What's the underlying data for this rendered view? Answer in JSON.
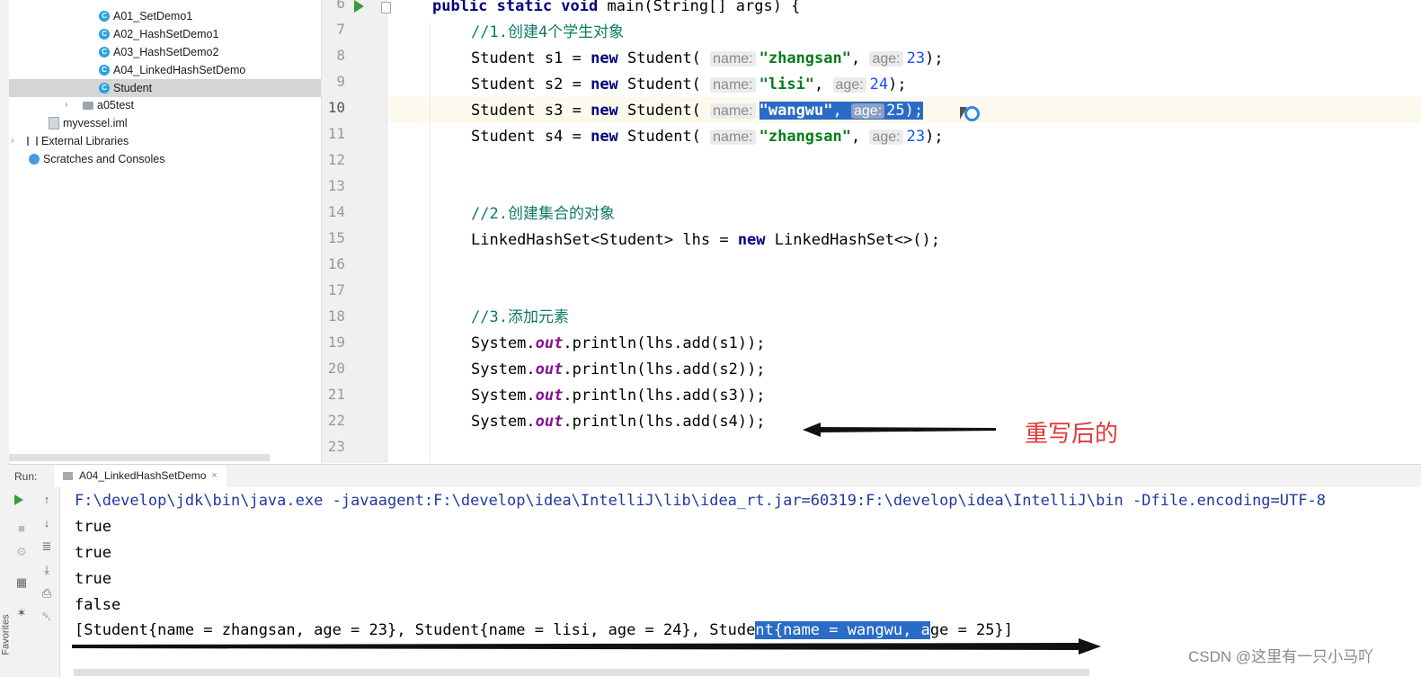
{
  "sidebar": {
    "favorites": "Favorites",
    "items": [
      {
        "label": "A01_SetDemo1",
        "icon": "class-icon"
      },
      {
        "label": "A02_HashSetDemo1",
        "icon": "class-icon"
      },
      {
        "label": "A03_HashSetDemo2",
        "icon": "class-icon"
      },
      {
        "label": "A04_LinkedHashSetDemo",
        "icon": "class-icon"
      },
      {
        "label": "Student",
        "icon": "class-icon",
        "selected": true
      },
      {
        "label": "a05test",
        "icon": "folder-icon"
      },
      {
        "label": "myvessel.iml",
        "icon": "iml-icon"
      },
      {
        "label": "External Libraries",
        "icon": "library-icon"
      },
      {
        "label": "Scratches and Consoles",
        "icon": "scratch-icon"
      }
    ]
  },
  "editor": {
    "line_numbers": [
      "6",
      "7",
      "8",
      "9",
      "10",
      "11",
      "12",
      "13",
      "14",
      "15",
      "16",
      "17",
      "18",
      "19",
      "20",
      "21",
      "22",
      "23"
    ],
    "current_line": "10",
    "code": {
      "l6_a": "public static void ",
      "l6_b": "main(String[] args) {",
      "l7": "//1.创建4个学生对象",
      "student_decl": "Student ",
      "new_kw": "new",
      "student_ctor": " Student( ",
      "name_hint": "name:",
      "age_hint": "age:",
      "s1": "s1 = ",
      "s1_name": "\"zhangsan\"",
      "s1_age": "23",
      "s2": "s2 = ",
      "s2_name": "\"lisi\"",
      "s2_age": "24",
      "s3": "s3 = ",
      "s3_name": "\"wangwu\"",
      "s3_age": "25",
      "s4": "s4 = ",
      "s4_name": "\"zhangsan\"",
      "s4_age": "23",
      "close": ");",
      "comma": ", ",
      "l14": "//2.创建集合的对象",
      "l15_a": "LinkedHashSet<Student> lhs = ",
      "l15_b": " LinkedHashSet<>();",
      "l18": "//3.添加元素",
      "sys": "System.",
      "out": "out",
      "add1": ".println(lhs.add(s1));",
      "add2": ".println(lhs.add(s2));",
      "add3": ".println(lhs.add(s3));",
      "add4": ".println(lhs.add(s4));"
    }
  },
  "annotation": {
    "text": "重写后的",
    "color": "#e0393b"
  },
  "run_panel": {
    "label": "Run:",
    "tab": "A04_LinkedHashSetDemo",
    "close": "×",
    "console": {
      "command": "F:\\develop\\jdk\\bin\\java.exe -javaagent:F:\\develop\\idea\\IntelliJ\\lib\\idea_rt.jar=60319:F:\\develop\\idea\\IntelliJ\\bin -Dfile.encoding=UTF-8",
      "out1": "true",
      "out2": "true",
      "out3": "true",
      "out4": "false",
      "result_a": "[Student{name = zhangsan, age = 23}, Student{name = lisi, age = 24}, Stude",
      "result_sel": "nt{name = wangwu, a",
      "result_b": "ge = 25}]"
    }
  },
  "watermark": "CSDN @这里有一只小马吖",
  "colors": {
    "keyword": "#000080",
    "comment": "#0b7a65",
    "string": "#067d17",
    "number": "#1750eb",
    "selection": "#2a6bc7"
  }
}
